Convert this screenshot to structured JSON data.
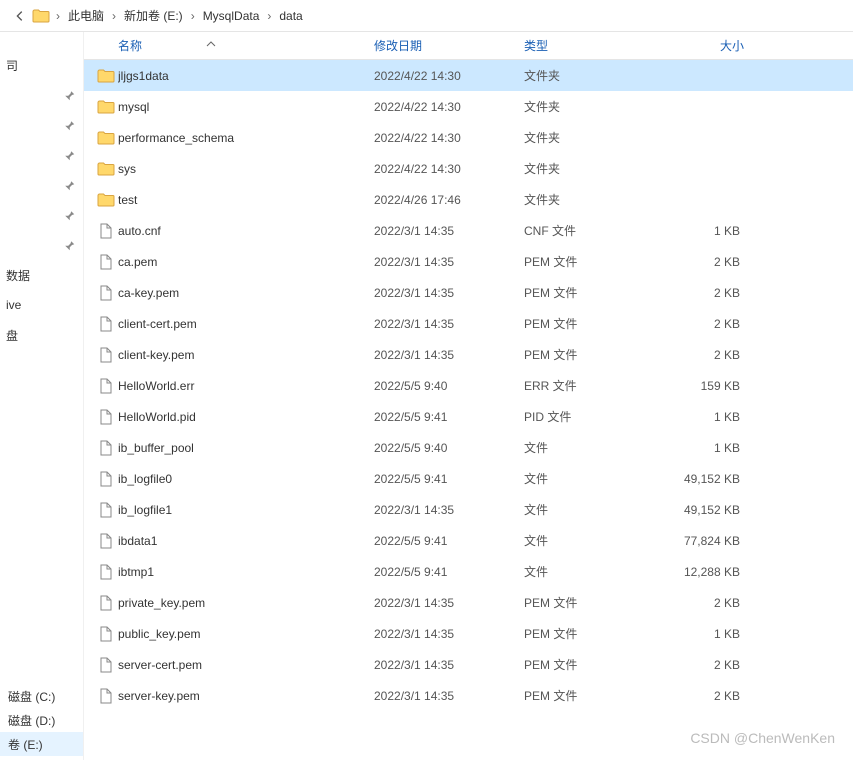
{
  "breadcrumb": {
    "items": [
      "此电脑",
      "新加卷 (E:)",
      "MysqlData",
      "data"
    ]
  },
  "sidebar": {
    "items": [
      {
        "label": "司"
      },
      {
        "label": ""
      },
      {
        "label": ""
      },
      {
        "label": ""
      },
      {
        "label": ""
      },
      {
        "label": ""
      },
      {
        "label": ""
      },
      {
        "label": "数据"
      },
      {
        "label": "ive"
      },
      {
        "label": "盘"
      }
    ],
    "drives": [
      {
        "label": "磁盘 (C:)"
      },
      {
        "label": "磁盘 (D:)"
      },
      {
        "label": "卷 (E:)",
        "selected": true
      }
    ]
  },
  "columns": {
    "name": "名称",
    "date": "修改日期",
    "type": "类型",
    "size": "大小"
  },
  "rows": [
    {
      "icon": "folder",
      "name": "jljgs1data",
      "date": "2022/4/22 14:30",
      "type": "文件夹",
      "size": "",
      "selected": true
    },
    {
      "icon": "folder",
      "name": "mysql",
      "date": "2022/4/22 14:30",
      "type": "文件夹",
      "size": ""
    },
    {
      "icon": "folder",
      "name": "performance_schema",
      "date": "2022/4/22 14:30",
      "type": "文件夹",
      "size": ""
    },
    {
      "icon": "folder",
      "name": "sys",
      "date": "2022/4/22 14:30",
      "type": "文件夹",
      "size": ""
    },
    {
      "icon": "folder",
      "name": "test",
      "date": "2022/4/26 17:46",
      "type": "文件夹",
      "size": ""
    },
    {
      "icon": "file",
      "name": "auto.cnf",
      "date": "2022/3/1 14:35",
      "type": "CNF 文件",
      "size": "1 KB"
    },
    {
      "icon": "file",
      "name": "ca.pem",
      "date": "2022/3/1 14:35",
      "type": "PEM 文件",
      "size": "2 KB"
    },
    {
      "icon": "file",
      "name": "ca-key.pem",
      "date": "2022/3/1 14:35",
      "type": "PEM 文件",
      "size": "2 KB"
    },
    {
      "icon": "file",
      "name": "client-cert.pem",
      "date": "2022/3/1 14:35",
      "type": "PEM 文件",
      "size": "2 KB"
    },
    {
      "icon": "file",
      "name": "client-key.pem",
      "date": "2022/3/1 14:35",
      "type": "PEM 文件",
      "size": "2 KB"
    },
    {
      "icon": "file",
      "name": "HelloWorld.err",
      "date": "2022/5/5 9:40",
      "type": "ERR 文件",
      "size": "159 KB"
    },
    {
      "icon": "file",
      "name": "HelloWorld.pid",
      "date": "2022/5/5 9:41",
      "type": "PID 文件",
      "size": "1 KB"
    },
    {
      "icon": "file",
      "name": "ib_buffer_pool",
      "date": "2022/5/5 9:40",
      "type": "文件",
      "size": "1 KB"
    },
    {
      "icon": "file",
      "name": "ib_logfile0",
      "date": "2022/5/5 9:41",
      "type": "文件",
      "size": "49,152 KB"
    },
    {
      "icon": "file",
      "name": "ib_logfile1",
      "date": "2022/3/1 14:35",
      "type": "文件",
      "size": "49,152 KB"
    },
    {
      "icon": "file",
      "name": "ibdata1",
      "date": "2022/5/5 9:41",
      "type": "文件",
      "size": "77,824 KB"
    },
    {
      "icon": "file",
      "name": "ibtmp1",
      "date": "2022/5/5 9:41",
      "type": "文件",
      "size": "12,288 KB"
    },
    {
      "icon": "file",
      "name": "private_key.pem",
      "date": "2022/3/1 14:35",
      "type": "PEM 文件",
      "size": "2 KB"
    },
    {
      "icon": "file",
      "name": "public_key.pem",
      "date": "2022/3/1 14:35",
      "type": "PEM 文件",
      "size": "1 KB"
    },
    {
      "icon": "file",
      "name": "server-cert.pem",
      "date": "2022/3/1 14:35",
      "type": "PEM 文件",
      "size": "2 KB"
    },
    {
      "icon": "file",
      "name": "server-key.pem",
      "date": "2022/3/1 14:35",
      "type": "PEM 文件",
      "size": "2 KB"
    }
  ],
  "watermark": "CSDN @ChenWenKen"
}
